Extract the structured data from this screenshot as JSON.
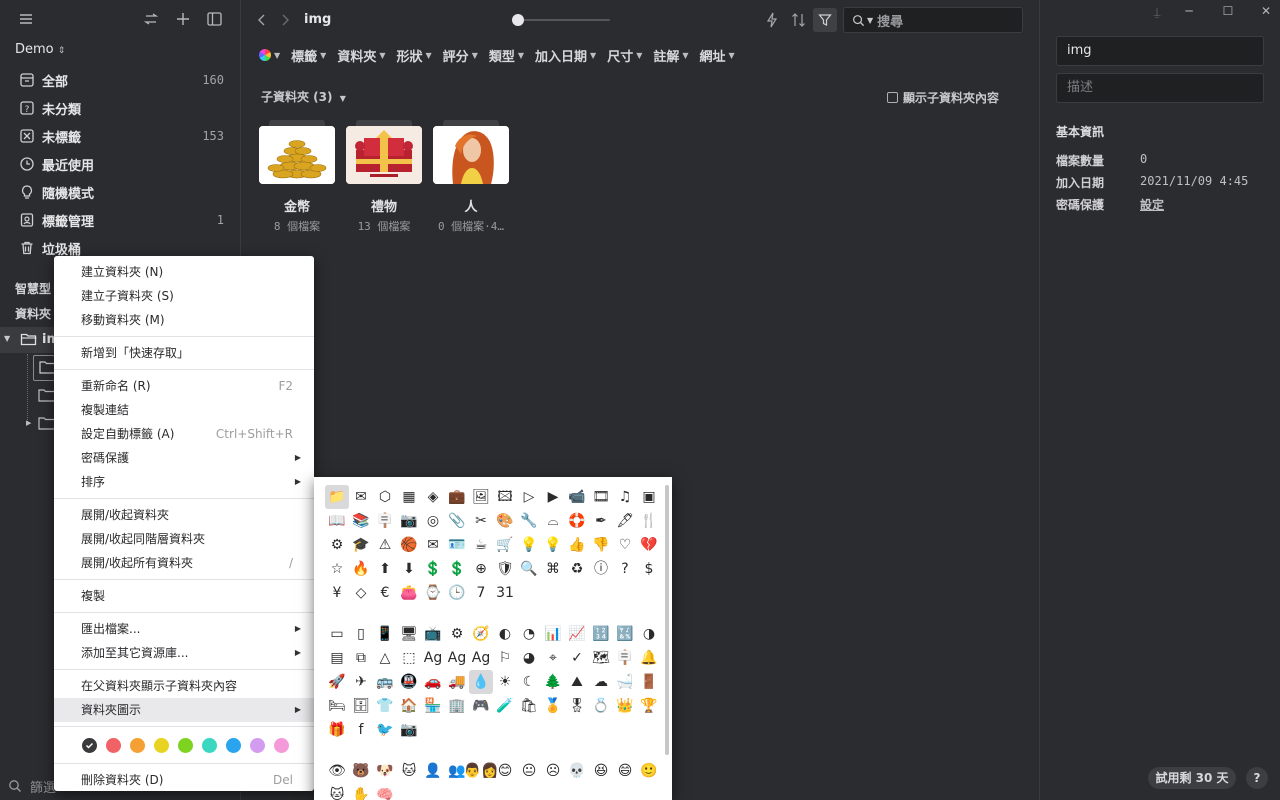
{
  "sidebar": {
    "library_name": "Demo",
    "nav": [
      {
        "label": "全部",
        "count": "160",
        "icon": "all-items-icon"
      },
      {
        "label": "未分類",
        "count": "",
        "icon": "unfiled-icon"
      },
      {
        "label": "未標籤",
        "count": "153",
        "icon": "untagged-icon"
      },
      {
        "label": "最近使用",
        "count": "",
        "icon": "recent-icon"
      },
      {
        "label": "隨機模式",
        "count": "",
        "icon": "random-icon"
      },
      {
        "label": "標籤管理",
        "count": "1",
        "icon": "tag-manager-icon"
      },
      {
        "label": "垃圾桶",
        "count": "",
        "icon": "trash-icon"
      }
    ],
    "smart_folders_label": "智慧型",
    "folders_label": "資料夾",
    "tree_root_label": "im",
    "search_placeholder": "篩選"
  },
  "toolbar": {
    "folder_title": "img",
    "search_placeholder": "搜尋"
  },
  "filters": [
    "標籤",
    "資料夾",
    "形狀",
    "評分",
    "類型",
    "加入日期",
    "尺寸",
    "註解",
    "網址"
  ],
  "subfolders": {
    "header": "子資料夾 (3)",
    "show_sub_label": "顯示子資料夾內容",
    "items": [
      {
        "name": "金幣",
        "count": "8 個檔案"
      },
      {
        "name": "禮物",
        "count": "13 個檔案"
      },
      {
        "name": "人",
        "count": "0 個檔案·4…"
      }
    ]
  },
  "inspector": {
    "name_value": "img",
    "desc_placeholder": "描述",
    "section_title": "基本資訊",
    "rows": [
      {
        "label": "檔案數量",
        "value": "0"
      },
      {
        "label": "加入日期",
        "value": "2021/11/09 4:45"
      },
      {
        "label": "密碼保護",
        "value": "設定"
      }
    ],
    "trial_label": "試用剩 30 天",
    "help_label": "?"
  },
  "context_menu": {
    "groups": [
      [
        {
          "label": "建立資料夾 (N)",
          "shortcut": "",
          "submenu": false
        },
        {
          "label": "建立子資料夾 (S)",
          "shortcut": "",
          "submenu": false
        },
        {
          "label": "移動資料夾 (M)",
          "shortcut": "",
          "submenu": false
        }
      ],
      [
        {
          "label": "新增到「快速存取」",
          "shortcut": "",
          "submenu": false
        }
      ],
      [
        {
          "label": "重新命名 (R)",
          "shortcut": "F2",
          "submenu": false
        },
        {
          "label": "複製連結",
          "shortcut": "",
          "submenu": false
        },
        {
          "label": "設定自動標籤 (A)",
          "shortcut": "Ctrl+Shift+R",
          "submenu": false
        },
        {
          "label": "密碼保護",
          "shortcut": "",
          "submenu": true
        },
        {
          "label": "排序",
          "shortcut": "",
          "submenu": true
        }
      ],
      [
        {
          "label": "展開/收起資料夾",
          "shortcut": "",
          "submenu": false
        },
        {
          "label": "展開/收起同階層資料夾",
          "shortcut": "",
          "submenu": false
        },
        {
          "label": "展開/收起所有資料夾",
          "shortcut": "/",
          "submenu": false
        }
      ],
      [
        {
          "label": "複製",
          "shortcut": "",
          "submenu": false
        }
      ],
      [
        {
          "label": "匯出檔案...",
          "shortcut": "",
          "submenu": true
        },
        {
          "label": "添加至其它資源庫...",
          "shortcut": "",
          "submenu": true
        }
      ],
      [
        {
          "label": "在父資料夾顯示子資料夾內容",
          "shortcut": "",
          "submenu": false
        },
        {
          "label": "資料夾圖示",
          "shortcut": "",
          "submenu": true,
          "highlighted": true
        }
      ]
    ],
    "colors": [
      "#3a3a3c",
      "#f06266",
      "#f4a035",
      "#e8d321",
      "#7ed321",
      "#3ad8c0",
      "#2ba4f0",
      "#d49cf0",
      "#f59ad8"
    ],
    "delete_label": "刪除資料夾 (D)",
    "delete_shortcut": "Del"
  },
  "icon_picker": {
    "group1": [
      "📁",
      "✉",
      "⬡",
      "▦",
      "◈",
      "💼",
      "🖼",
      "🖾",
      "▷",
      "▶",
      "📹",
      "🎞",
      "♫",
      "▣",
      "📖",
      "📚",
      "🪧",
      "📷",
      "◎",
      "📎",
      "✂",
      "🎨",
      "🔧",
      "⌓",
      "🛟",
      "✒",
      "🖋",
      "🍴",
      "⚙",
      "🎓",
      "⚠",
      "🏀",
      "✉",
      "🪪",
      "☕",
      "🛒",
      "💡",
      "💡",
      "👍",
      "👎",
      "♡",
      "💔",
      "☆",
      "🔥",
      "⬆",
      "⬇",
      "💲",
      "💲",
      "⊕",
      "🛡",
      "🔍",
      "⌘",
      "♻",
      "ⓘ",
      "?",
      "$",
      "¥",
      "◇",
      "€",
      "👛",
      "⌚",
      "🕒",
      "7",
      "31"
    ],
    "group2": [
      "▭",
      "▯",
      "📱",
      "🖥",
      "📺",
      "⚙",
      "🧭",
      "◐",
      "◔",
      "📊",
      "📈",
      "🔢",
      "🔣",
      "◑",
      "▤",
      "⧉",
      "△",
      "⬚",
      "Ag",
      "Ag",
      "Ag",
      "⚐",
      "◕",
      "⌖",
      "✓",
      "🗺",
      "🪧",
      "🔔",
      "🚀",
      "✈",
      "🚌",
      "🚇",
      "🚗",
      "🚚",
      "💧",
      "☀",
      "☾",
      "🌲",
      "⛰",
      "☁",
      "🛁",
      "🚪",
      "🛏",
      "🗄",
      "👕",
      "🏠",
      "🏪",
      "🏢",
      "🎮",
      "🧪",
      "🛍",
      "🏅",
      "🎖",
      "💍",
      "👑",
      "🏆",
      "🎁",
      "f",
      "🐦",
      "📷"
    ],
    "group3": [
      "👁",
      "🐻",
      "🐶",
      "🐱",
      "👤",
      "👥",
      "👨‍👩",
      "😊",
      "😐",
      "☹",
      "💀",
      "😆",
      "😄",
      "🙂",
      "🐱",
      "✋",
      "🧠"
    ]
  }
}
